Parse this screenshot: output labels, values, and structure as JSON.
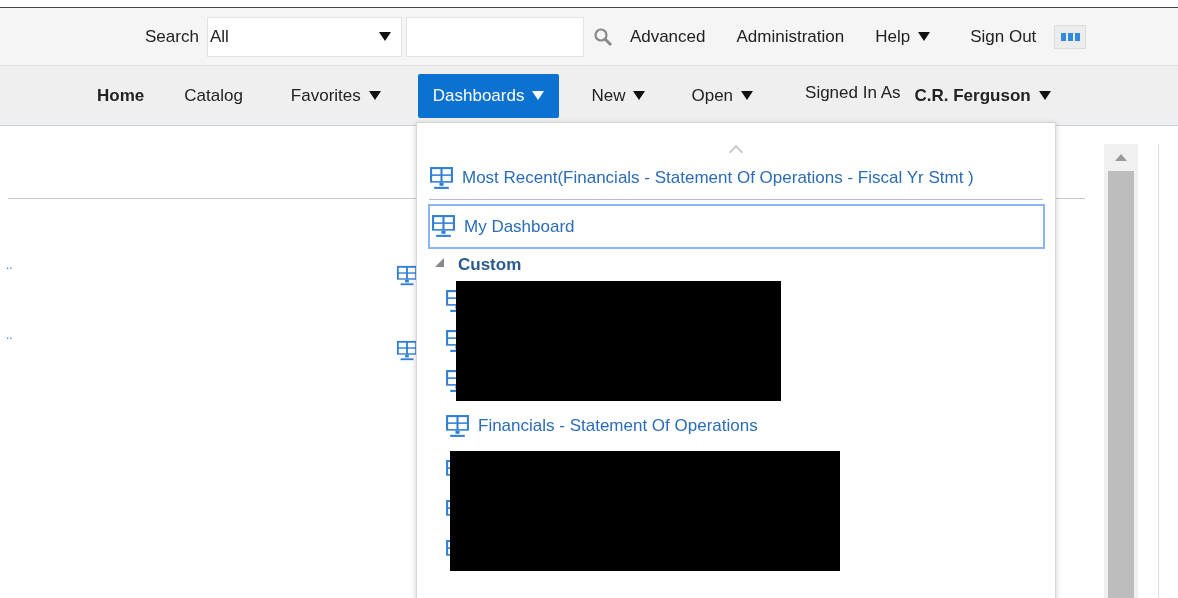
{
  "header": {
    "search_label": "Search",
    "scope": "All",
    "links": [
      {
        "label": "Advanced",
        "dropdown": false
      },
      {
        "label": "Administration",
        "dropdown": false
      },
      {
        "label": "Help",
        "dropdown": true
      },
      {
        "label": "Sign Out",
        "dropdown": false
      }
    ]
  },
  "nav": {
    "items": [
      {
        "label": "Home",
        "selected": false,
        "bold": true,
        "dropdown": false
      },
      {
        "label": "Catalog",
        "selected": false,
        "bold": false,
        "dropdown": false
      },
      {
        "label": "Favorites",
        "selected": false,
        "bold": false,
        "dropdown": true
      },
      {
        "label": "Dashboards",
        "selected": true,
        "bold": false,
        "dropdown": true
      },
      {
        "label": "New",
        "selected": false,
        "bold": false,
        "dropdown": true
      },
      {
        "label": "Open",
        "selected": false,
        "bold": false,
        "dropdown": true
      }
    ],
    "signed_in_label": "Signed In As",
    "user": "C.R. Ferguson"
  },
  "background_links": [
    "..",
    ".."
  ],
  "menu": {
    "most_recent": "Most Recent(Financials - Statement Of Operations - Fiscal Yr Stmt )",
    "my_dashboard": {
      "label": "My Dashboard",
      "focused": true
    },
    "section": {
      "label": "Custom",
      "expanded": true,
      "items": [
        {
          "kind": "redacted"
        },
        {
          "kind": "redacted"
        },
        {
          "kind": "redacted"
        },
        {
          "kind": "dashboard",
          "label": "Financials - Statement Of Operations"
        },
        {
          "kind": "redacted"
        },
        {
          "kind": "redacted"
        },
        {
          "kind": "redacted"
        }
      ]
    }
  }
}
